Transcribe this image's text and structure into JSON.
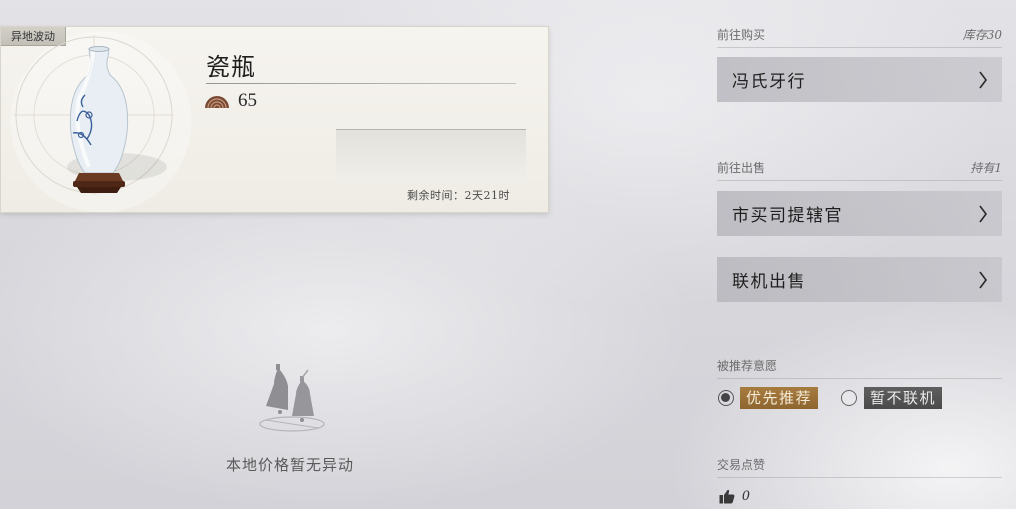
{
  "item": {
    "tag": "异地波动",
    "name": "瓷瓶",
    "price": "65",
    "price_icon": "coin-icon",
    "remaining": "剩余时间：2天21时"
  },
  "empty_state": {
    "icon": "bells-icon",
    "text": "本地价格暂无异动"
  },
  "buy": {
    "header": "前往购买",
    "stock": "库存30",
    "options": [
      {
        "label": "冯氏牙行"
      }
    ]
  },
  "sell": {
    "header": "前往出售",
    "held": "持有1",
    "options": [
      {
        "label": "市买司提辖官"
      },
      {
        "label": "联机出售"
      }
    ]
  },
  "recommend": {
    "header": "被推荐意愿",
    "options": [
      {
        "label": "优先推荐",
        "selected": true
      },
      {
        "label": "暂不联机",
        "selected": false
      }
    ]
  },
  "likes": {
    "header": "交易点赞",
    "count": "0",
    "icon": "thumbs-up-icon"
  },
  "colors": {
    "accent_gold": "#9b7038",
    "chip_gray": "#555556",
    "button_bg": "#b6b6bc"
  }
}
